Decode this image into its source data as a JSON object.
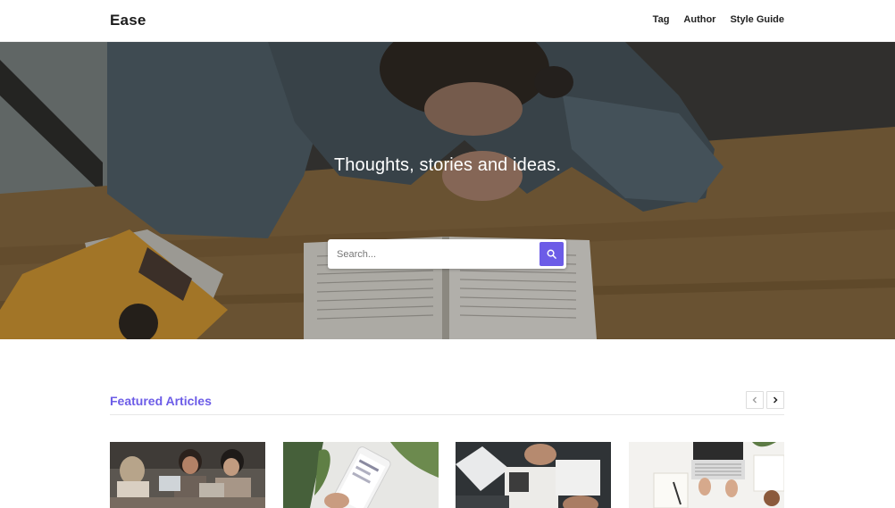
{
  "header": {
    "brand": "Ease",
    "nav": [
      "Tag",
      "Author",
      "Style Guide"
    ]
  },
  "hero": {
    "title": "Thoughts, stories and ideas.",
    "search_placeholder": "Search..."
  },
  "featured": {
    "title": "Featured Articles"
  },
  "icons": {
    "search": "search-icon",
    "prev": "chevron-left-icon",
    "next": "chevron-right-icon"
  },
  "colors": {
    "accent": "#6c5ce7",
    "text": "#222222"
  }
}
